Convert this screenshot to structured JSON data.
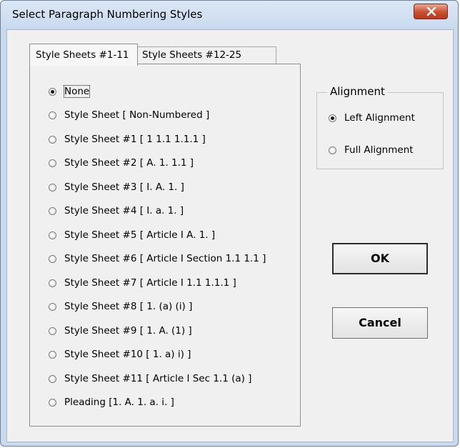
{
  "window": {
    "title": "Select Paragraph Numbering Styles"
  },
  "tabs": [
    {
      "label": "Style Sheets #1-11",
      "active": true
    },
    {
      "label": "Style Sheets #12-25",
      "active": false
    }
  ],
  "options": [
    {
      "label": "None",
      "checked": true
    },
    {
      "label": "Style Sheet [ Non-Numbered ]",
      "checked": false
    },
    {
      "label": "Style Sheet #1 [ 1 1.1 1.1.1 ]",
      "checked": false
    },
    {
      "label": "Style Sheet #2 [ A. 1. 1.1 ]",
      "checked": false
    },
    {
      "label": "Style Sheet #3 [ I. A. 1. ]",
      "checked": false
    },
    {
      "label": "Style Sheet #4 [ I. a. 1. ]",
      "checked": false
    },
    {
      "label": "Style Sheet #5 [ Article I A. 1. ]",
      "checked": false
    },
    {
      "label": "Style Sheet #6 [ Article I Section 1.1 1.1 ]",
      "checked": false
    },
    {
      "label": "Style Sheet #7 [ Article I 1.1 1.1.1 ]",
      "checked": false
    },
    {
      "label": "Style Sheet #8 [ 1. (a) (i) ]",
      "checked": false
    },
    {
      "label": "Style Sheet #9 [ 1. A. (1) ]",
      "checked": false
    },
    {
      "label": "Style Sheet #10 [ 1. a) i) ]",
      "checked": false
    },
    {
      "label": "Style Sheet #11 [ Article I Sec 1.1 (a) ]",
      "checked": false
    },
    {
      "label": "Pleading [1. A. 1. a. i. ]",
      "checked": false
    }
  ],
  "alignment": {
    "legend": "Alignment",
    "options": [
      {
        "label": "Left Alignment",
        "checked": true
      },
      {
        "label": "Full Alignment",
        "checked": false
      }
    ]
  },
  "buttons": {
    "ok": "OK",
    "cancel": "Cancel"
  },
  "icons": {
    "close": "close-icon"
  }
}
